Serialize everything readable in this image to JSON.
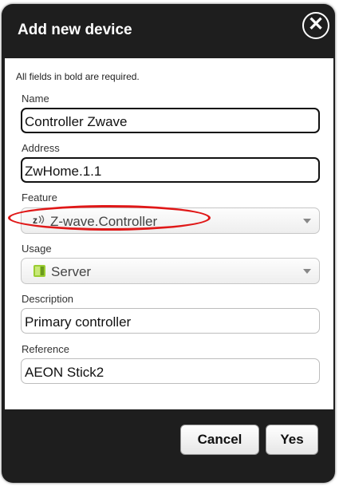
{
  "dialog": {
    "title": "Add new device",
    "close_label": "✕"
  },
  "form": {
    "required_note": "All fields in bold are required.",
    "name": {
      "label": "Name",
      "value": "Controller Zwave"
    },
    "address": {
      "label": "Address",
      "value": "ZwHome.1.1"
    },
    "feature": {
      "label": "Feature",
      "value": "Z-wave.Controller",
      "icon": "zwave-icon",
      "icon_text": "z"
    },
    "usage": {
      "label": "Usage",
      "value": "Server",
      "icon": "server-icon"
    },
    "description": {
      "label": "Description",
      "value": "Primary controller"
    },
    "reference": {
      "label": "Reference",
      "value": "AEON Stick2"
    }
  },
  "buttons": {
    "cancel": "Cancel",
    "yes": "Yes"
  },
  "colors": {
    "dialog_bg": "#1e1e1e",
    "highlight": "#e01818"
  }
}
